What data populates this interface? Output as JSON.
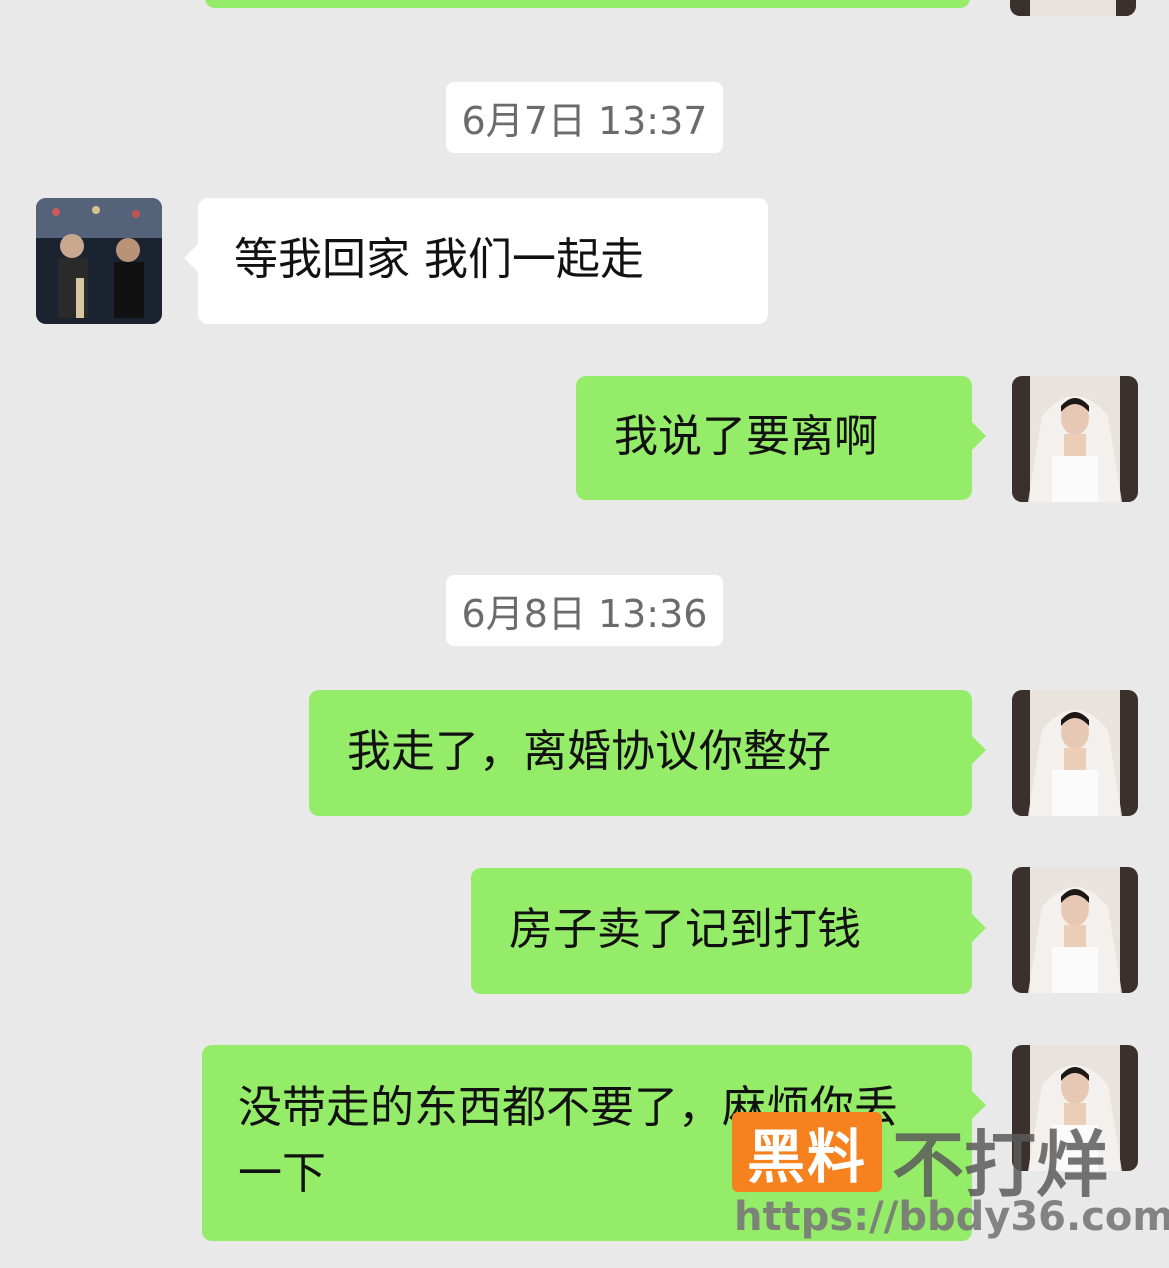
{
  "colors": {
    "background": "#e9e9e9",
    "incoming_bubble": "#ffffff",
    "outgoing_bubble": "#95ec69",
    "timestamp_bg": "#ffffff"
  },
  "timestamps": [
    "6月7日 13:37",
    "6月8日 13:36"
  ],
  "messages": [
    {
      "side": "incoming",
      "avatar": "contact-avatar",
      "text": "等我回家 我们一起走"
    },
    {
      "side": "outgoing",
      "avatar": "self-avatar",
      "text": "我说了要离啊"
    },
    {
      "side": "outgoing",
      "avatar": "self-avatar",
      "text": "我走了，离婚协议你整好"
    },
    {
      "side": "outgoing",
      "avatar": "self-avatar",
      "text": "房子卖了记到打钱"
    },
    {
      "side": "outgoing",
      "avatar": "self-avatar",
      "text": "没带走的东西都不要了，麻烦你丢一下"
    }
  ],
  "watermark": {
    "brand_highlight": "黑料",
    "brand_rest": "不打烊",
    "url": "https://bbdy36.com"
  }
}
